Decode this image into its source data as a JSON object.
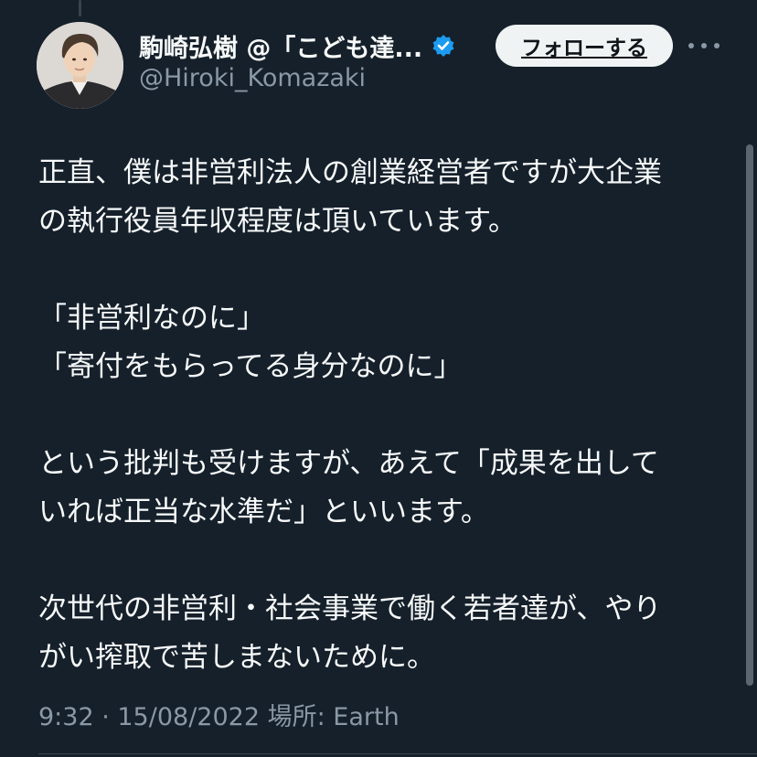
{
  "header": {
    "display_name": "駒崎弘樹 @「こども達...",
    "handle": "@Hiroki_Komazaki",
    "follow_label": "フォローする"
  },
  "tweet": {
    "paragraphs": [
      [
        "正直、僕は非営利法人の創業経営者ですが大企業",
        "の執行役員年収程度は頂いています。"
      ],
      [
        "「非営利なのに」",
        "「寄付をもらってる身分なのに」"
      ],
      [
        "という批判も受けますが、あえて「成果を出して",
        "いれば正当な水準だ」といいます。"
      ],
      [
        "次世代の非営利・社会事業で働く若者達が、やり",
        "がい搾取で苦しまないために。"
      ]
    ],
    "timestamp": "9:32 · 15/08/2022",
    "location": "場所: Earth"
  },
  "icons": {
    "verified": "verified-badge-icon",
    "more": "more-options-icon",
    "accent": "#1d9bf0"
  }
}
